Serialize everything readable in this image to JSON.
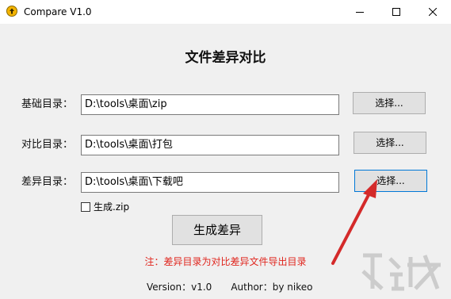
{
  "window": {
    "title": "Compare V1.0"
  },
  "heading": "文件差异对比",
  "rows": [
    {
      "label": "基础目录：",
      "value": "D:\\tools\\桌面\\zip",
      "button": "选择..."
    },
    {
      "label": "对比目录：",
      "value": "D:\\tools\\桌面\\打包",
      "button": "选择..."
    },
    {
      "label": "差异目录：",
      "value": "D:\\tools\\桌面\\下载吧",
      "button": "选择..."
    }
  ],
  "zip_option": {
    "label": "生成.zip",
    "checked": false
  },
  "generate_button": "生成差异",
  "note": "注：差异目录为对比差异文件导出目录",
  "footer": {
    "version": "Version：v1.0",
    "author": "Author：by nikeo"
  },
  "colors": {
    "note": "#e0261e",
    "arrow": "#d42a2a",
    "focus_border": "#0078d7",
    "app_icon": "#f4b400"
  },
  "icons": {
    "app": "up-arrow-circle-icon",
    "minimize": "minimize-icon",
    "maximize": "maximize-icon",
    "close": "close-icon"
  }
}
